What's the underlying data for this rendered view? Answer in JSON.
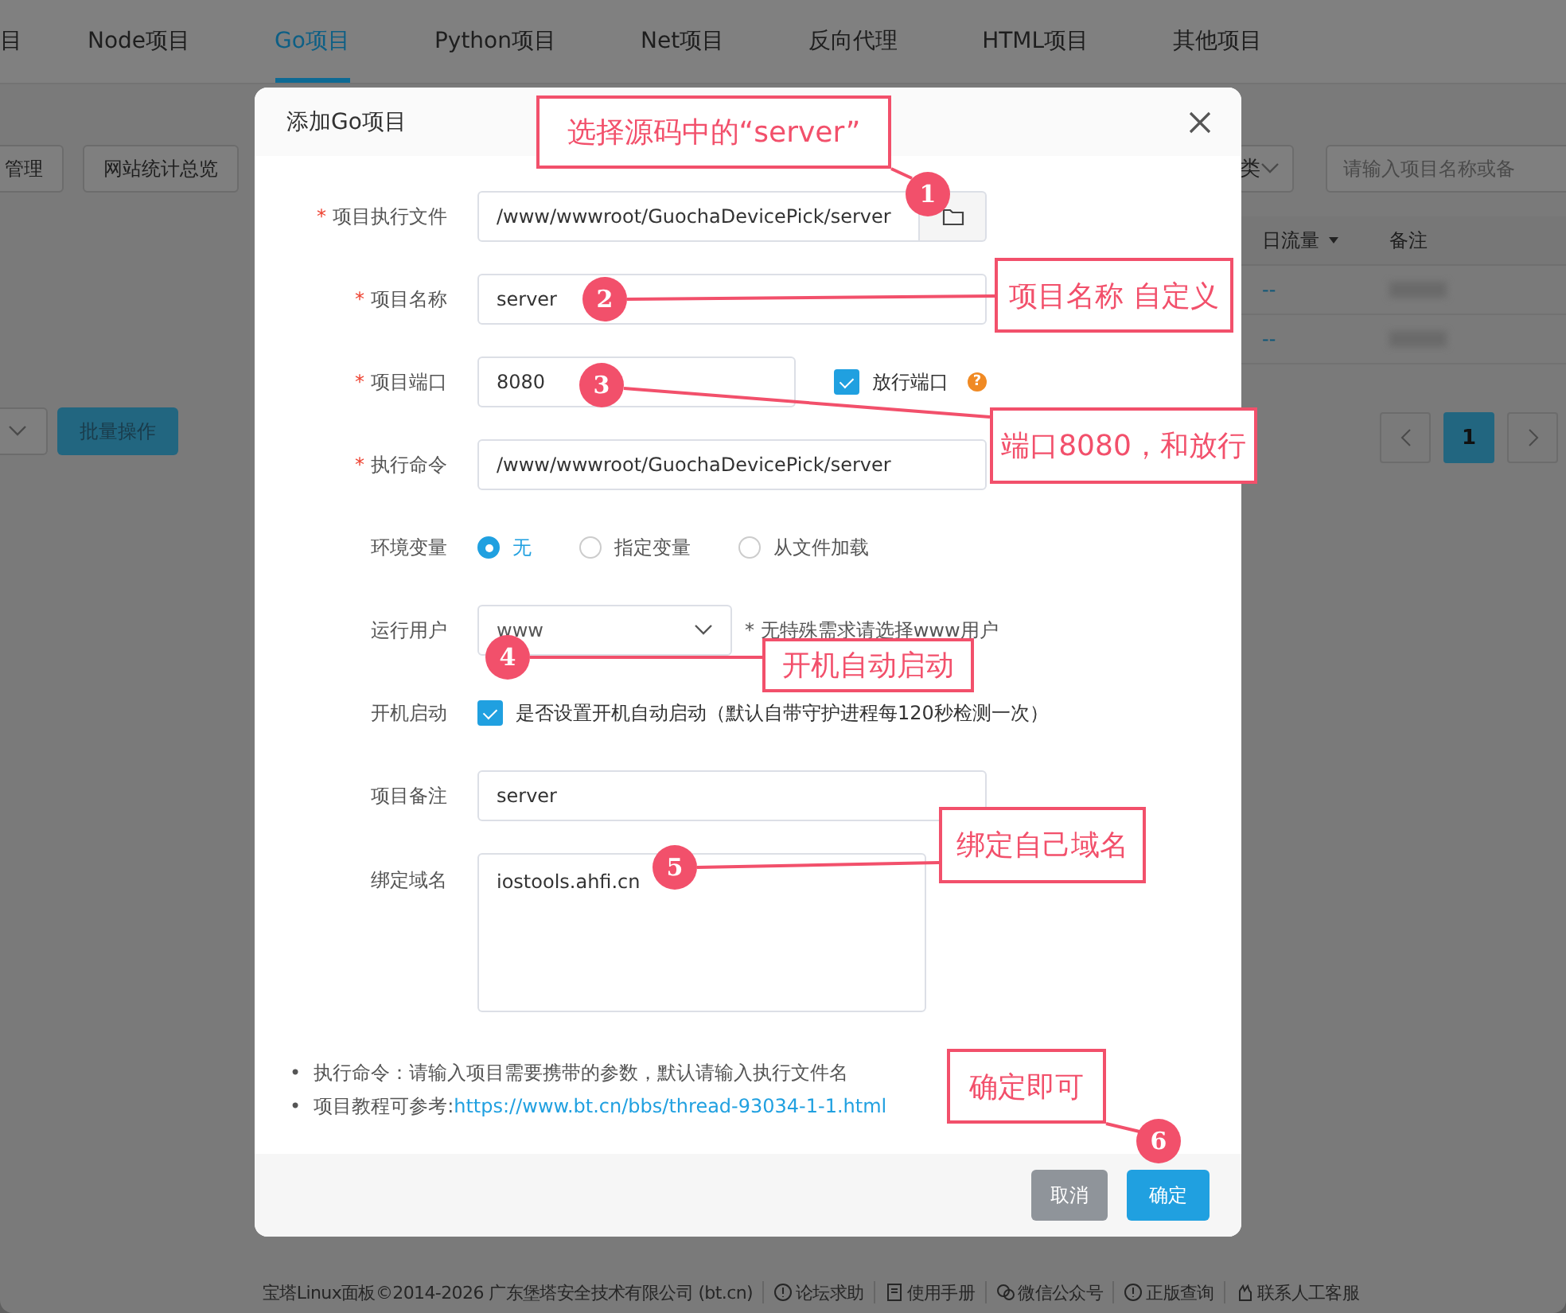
{
  "tabs": [
    {
      "label": "目",
      "selected": false
    },
    {
      "label": "Node项目",
      "selected": false
    },
    {
      "label": "Go项目",
      "selected": true
    },
    {
      "label": "Python项目",
      "selected": false
    },
    {
      "label": "Net项目",
      "selected": false
    },
    {
      "label": "反向代理",
      "selected": false
    },
    {
      "label": "HTML项目",
      "selected": false
    },
    {
      "label": "其他项目",
      "selected": false
    }
  ],
  "toolbar": {
    "buttons": [
      "管理",
      "网站统计总览"
    ],
    "filter": "类",
    "search": {
      "placeholder": "请输入项目名称或备"
    }
  },
  "table": {
    "columns": [
      "日流量",
      "备注"
    ],
    "rows": [
      {
        "traffic": "--"
      },
      {
        "traffic": "--"
      }
    ]
  },
  "bulk_action": {
    "button": "批量操作"
  },
  "pagination": {
    "pages": [
      {
        "label": "1",
        "selected": true
      }
    ]
  },
  "dialog": {
    "title": "添加Go项目",
    "fields": [
      {
        "kind": "file",
        "label": "项目执行文件",
        "required_mark": "*",
        "value": "/www/wwwroot/GuochaDevicePick/server"
      },
      {
        "kind": "text",
        "label": "项目名称",
        "required_mark": "*",
        "value": "server"
      },
      {
        "kind": "port",
        "label": "项目端口",
        "required_mark": "*",
        "value": "8080",
        "check_label": "放行端口",
        "checked": true,
        "help": "?"
      },
      {
        "kind": "text",
        "label": "执行命令",
        "required_mark": "*",
        "value": "/www/wwwroot/GuochaDevicePick/server"
      },
      {
        "kind": "radio",
        "label": "环境变量",
        "options": [
          {
            "label": "无",
            "selected": true
          },
          {
            "label": "指定变量",
            "selected": false
          },
          {
            "label": "从文件加载",
            "selected": false
          }
        ]
      },
      {
        "kind": "select",
        "label": "运行用户",
        "value": "www",
        "hint": "* 无特殊需求请选择www用户"
      },
      {
        "kind": "checkbox",
        "label": "开机启动",
        "checked": true,
        "text": "是否设置开机自动启动（默认自带守护进程每120秒检测一次）"
      },
      {
        "kind": "text",
        "label": "项目备注",
        "value": "server"
      },
      {
        "kind": "textarea",
        "label": "绑定域名",
        "value": "iostools.ahfi.cn"
      }
    ],
    "notes": [
      {
        "marker": "•",
        "text": "执行命令：请输入项目需要携带的参数，默认请输入执行文件名"
      },
      {
        "marker": "•",
        "text": "项目教程可参考:",
        "link": "https://www.bt.cn/bbs/thread-93034-1-1.html"
      }
    ],
    "buttons": [
      {
        "label": "取消",
        "kind": "cancel"
      },
      {
        "label": "确定",
        "kind": "primary"
      }
    ]
  },
  "annotations": [
    {
      "number": "1",
      "text": "选择源码中的“server”"
    },
    {
      "number": "2",
      "text": "项目名称 自定义"
    },
    {
      "number": "3",
      "text": "端口8080，和放行"
    },
    {
      "number": "4",
      "text": "开机自动启动"
    },
    {
      "number": "5",
      "text": "绑定自己域名"
    },
    {
      "number": "6",
      "text": "确定即可"
    }
  ],
  "footer": {
    "copyright": "宝塔Linux面板©2014-2026 广东堡塔安全技术有限公司 (bt.cn)",
    "links": [
      "论坛求助",
      "使用手册",
      "微信公众号",
      "正版查询",
      "联系人工客服"
    ]
  }
}
